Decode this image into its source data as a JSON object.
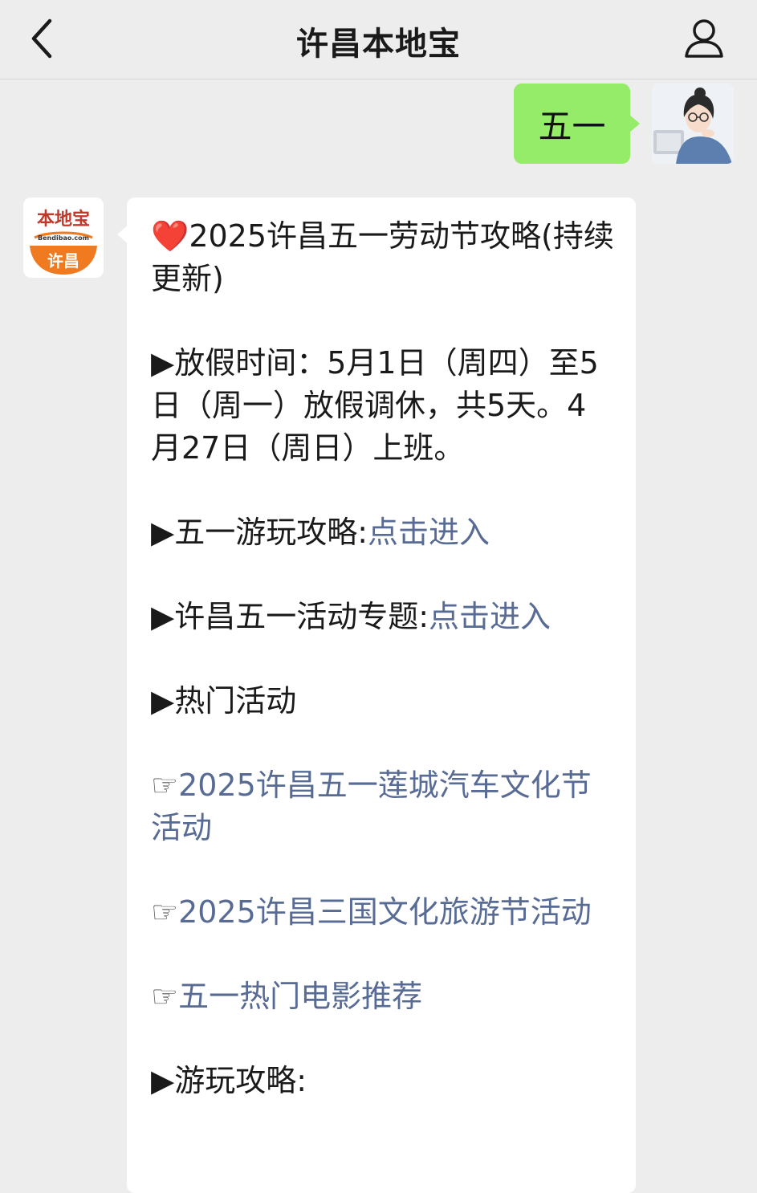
{
  "header": {
    "title": "许昌本地宝",
    "back_icon": "chevron-left-icon",
    "profile_icon": "person-icon"
  },
  "sent_message": {
    "text": "五一"
  },
  "bot": {
    "logo_top": "本地宝",
    "logo_sub": "Bendibao.com",
    "logo_city": "许昌"
  },
  "reply": {
    "heart": "❤️",
    "title": "2025许昌五一劳动节攻略(持续更新)",
    "holiday_prefix": "▶放假时间：",
    "holiday_text": "5月1日（周四）至5日（周一）放假调休，共5天。4月27日（周日）上班。",
    "travel_label": "▶五一游玩攻略:",
    "travel_link": "点击进入",
    "topic_label": "▶许昌五一活动专题:",
    "topic_link": "点击进入",
    "hot_label": "▶热门活动",
    "hand": "☞",
    "event1": "2025许昌五一莲城汽车文化节活动",
    "event2": "2025许昌三国文化旅游节活动",
    "event3": "五一热门电影推荐",
    "guide_label": "▶游玩攻略:"
  },
  "colors": {
    "background": "#ededed",
    "sent_bubble": "#95ec69",
    "link": "#576b95",
    "logo_orange": "#f07a1f"
  }
}
